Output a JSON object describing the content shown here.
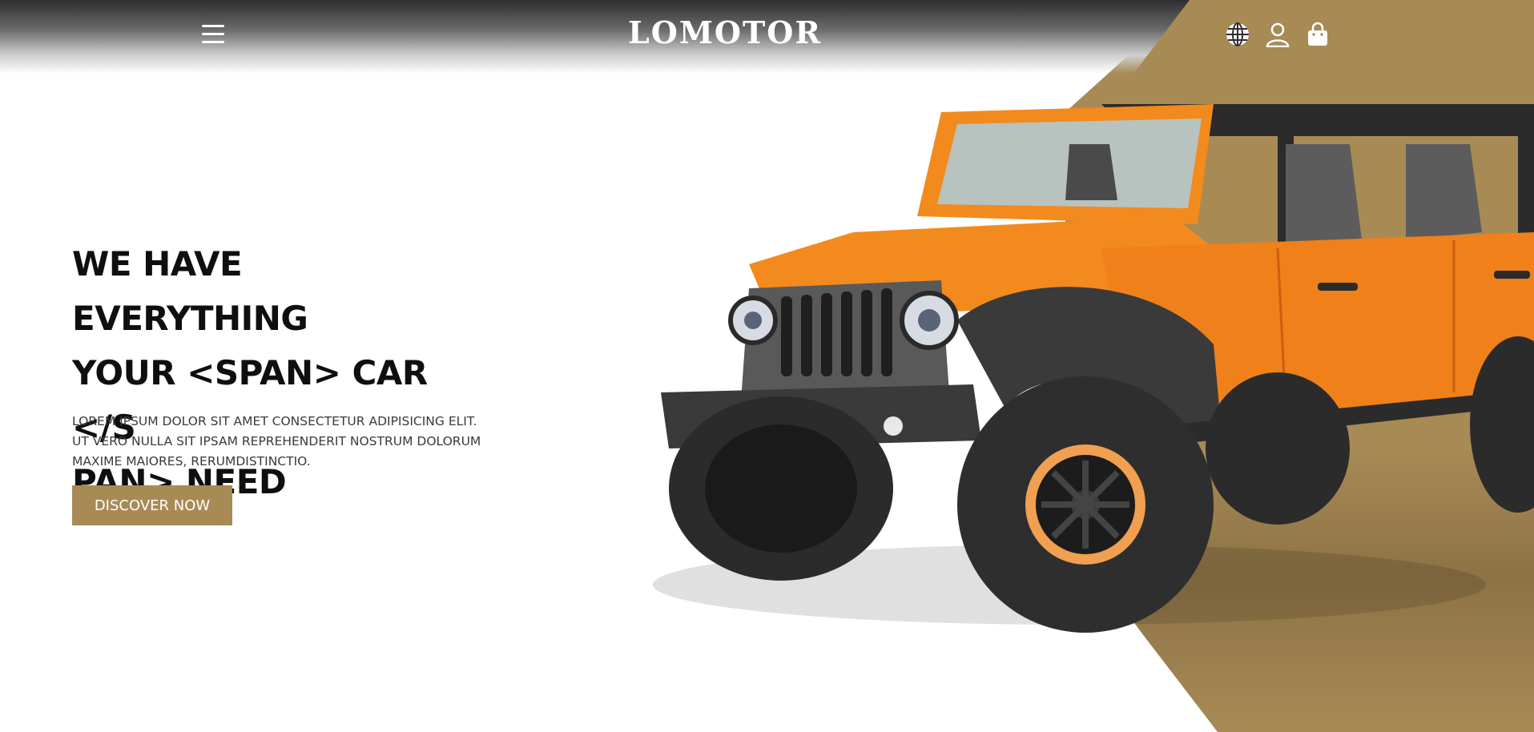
{
  "header": {
    "brand": "LOMOTOR",
    "menu_icon": "hamburger-menu-icon",
    "icons": [
      "globe-icon",
      "user-icon",
      "shopping-bag-icon"
    ]
  },
  "hero": {
    "title_lines": [
      "WE HAVE EVERYTHING",
      "YOUR <SPAN> CAR </S",
      "PAN> NEED"
    ],
    "description_lines": [
      "LOREM IPSUM DOLOR SIT AMET CONSECTETUR ADIPISICING ELIT.",
      "UT VERO NULLA SIT IPSAM REPREHENDERIT NOSTRUM DOLORUM",
      "MAXIME MAIORES, RERUMDISTINCTIO."
    ],
    "cta_label": "DISCOVER NOW",
    "image": "orange-jeep-image"
  },
  "colors": {
    "accent": "#a88a55",
    "car_body": "#f28a1e",
    "title": "#0f0f0f"
  }
}
